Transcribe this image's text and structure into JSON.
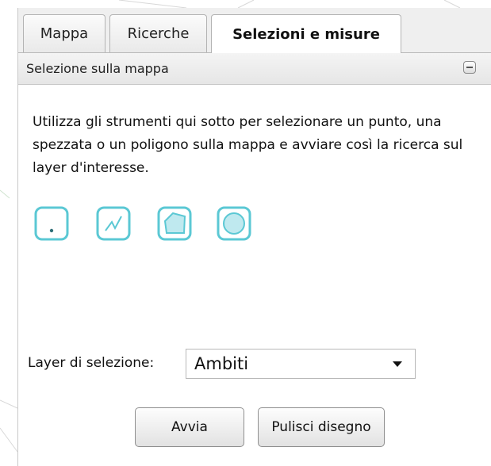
{
  "tabs": [
    {
      "label": "Mappa",
      "active": false
    },
    {
      "label": "Ricerche",
      "active": false
    },
    {
      "label": "Selezioni e misure",
      "active": true
    }
  ],
  "section": {
    "title": "Selezione sulla mappa",
    "collapse_icon": "minus-icon"
  },
  "description": "Utilizza gli strumenti qui sotto per selezionare un punto, una spezzata o un poligono sulla mappa e avviare così la ricerca sul layer d'interesse.",
  "tools": [
    {
      "icon": "point-select-icon"
    },
    {
      "icon": "polyline-select-icon"
    },
    {
      "icon": "polygon-select-icon"
    },
    {
      "icon": "circle-select-icon"
    }
  ],
  "layer": {
    "label": "Layer di selezione:",
    "selected": "Ambiti"
  },
  "buttons": {
    "start": "Avvia",
    "clear": "Pulisci disegno"
  },
  "colors": {
    "tool_accent": "#5bc8d4",
    "tool_fill": "#bfe9ef",
    "tab_strip": "#efefef"
  }
}
